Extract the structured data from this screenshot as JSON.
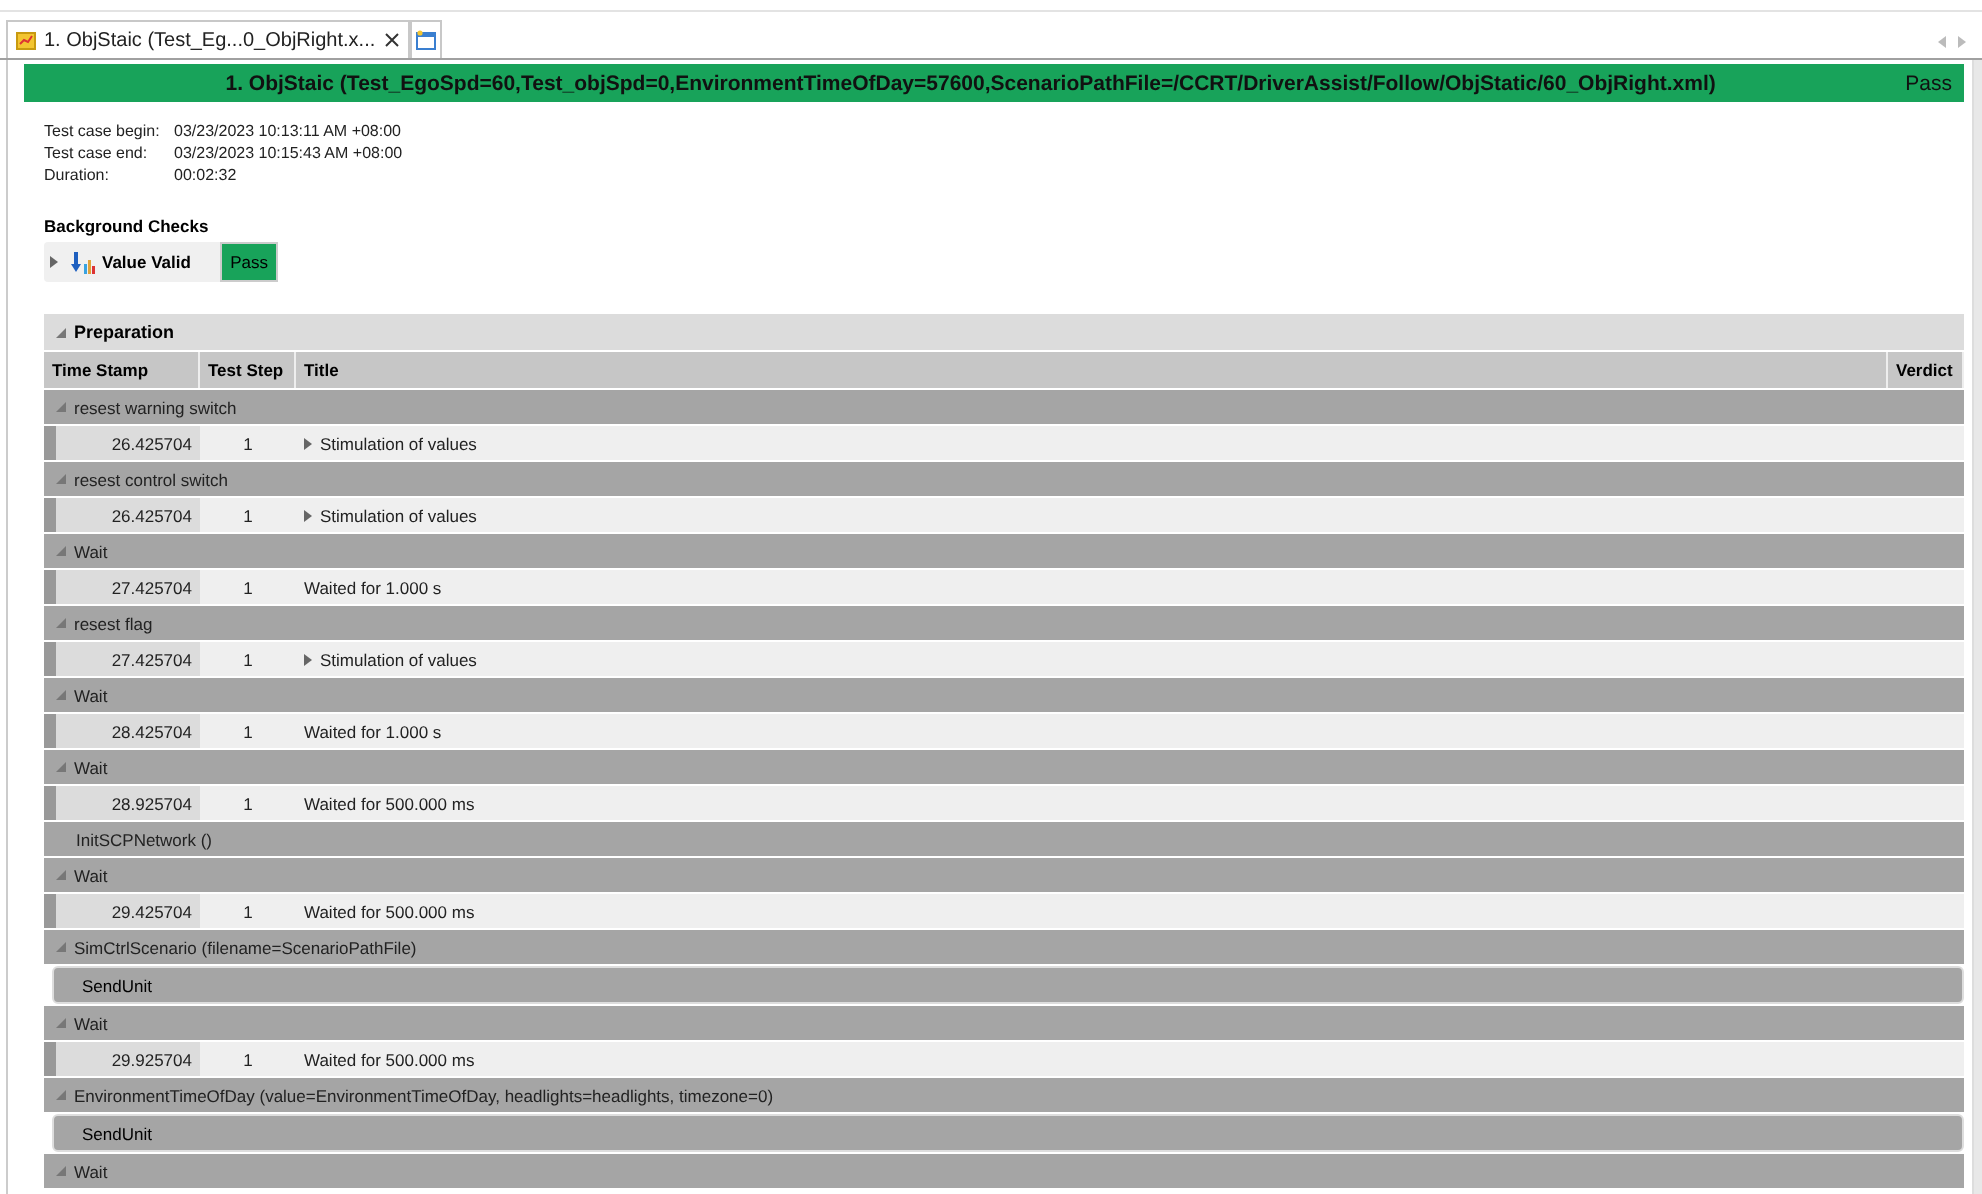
{
  "tab": {
    "title": "1. ObjStaic (Test_Eg...0_ObjRight.x...",
    "selected": true
  },
  "header": {
    "title": "1. ObjStaic (Test_EgoSpd=60,Test_objSpd=0,EnvironmentTimeOfDay=57600,ScenarioPathFile=/CCRT/DriverAssist/Follow/ObjStatic/60_ObjRight.xml)",
    "verdict": "Pass"
  },
  "details": [
    {
      "label": "Test case begin:",
      "value": "03/23/2023 10:13:11 AM +08:00"
    },
    {
      "label": "Test case end:",
      "value": "03/23/2023 10:15:43 AM +08:00"
    },
    {
      "label": "Duration:",
      "value": "00:02:32"
    }
  ],
  "background_checks": {
    "title": "Background Checks",
    "items": [
      {
        "name": "Value Valid",
        "verdict": "Pass",
        "expanded": false
      }
    ]
  },
  "section": {
    "title": "Preparation",
    "expanded": true,
    "columns": [
      "Time Stamp",
      "Test Step",
      "Title",
      "Verdict"
    ],
    "groups": [
      {
        "kind": "group",
        "title": "resest warning switch",
        "expanded": true,
        "rows": [
          {
            "kind": "detail",
            "time": "26.425704",
            "step": "1",
            "title": "Stimulation of values",
            "expanded": false
          }
        ]
      },
      {
        "kind": "group",
        "title": "resest control switch",
        "expanded": true,
        "rows": [
          {
            "kind": "detail",
            "time": "26.425704",
            "step": "1",
            "title": "Stimulation of values",
            "expanded": false
          }
        ]
      },
      {
        "kind": "group",
        "title": "Wait",
        "expanded": true,
        "rows": [
          {
            "kind": "plain",
            "time": "27.425704",
            "step": "1",
            "title": "Waited for 1.000 s"
          }
        ]
      },
      {
        "kind": "group",
        "title": "resest flag",
        "expanded": true,
        "rows": [
          {
            "kind": "detail",
            "time": "27.425704",
            "step": "1",
            "title": "Stimulation of values",
            "expanded": false
          }
        ]
      },
      {
        "kind": "group",
        "title": "Wait",
        "expanded": true,
        "rows": [
          {
            "kind": "plain",
            "time": "28.425704",
            "step": "1",
            "title": "Waited for 1.000 s"
          }
        ]
      },
      {
        "kind": "group",
        "title": "Wait",
        "expanded": true,
        "rows": [
          {
            "kind": "plain",
            "time": "28.925704",
            "step": "1",
            "title": "Waited for 500.000 ms"
          }
        ]
      },
      {
        "kind": "call",
        "title": "InitSCPNetwork ()"
      },
      {
        "kind": "group",
        "title": "Wait",
        "expanded": true,
        "rows": [
          {
            "kind": "plain",
            "time": "29.425704",
            "step": "1",
            "title": "Waited for 500.000 ms"
          }
        ]
      },
      {
        "kind": "group",
        "title": "SimCtrlScenario (filename=ScenarioPathFile)",
        "expanded": true,
        "rows": [
          {
            "kind": "sub",
            "title": "SendUnit"
          }
        ]
      },
      {
        "kind": "group",
        "title": "Wait",
        "expanded": true,
        "rows": [
          {
            "kind": "plain",
            "time": "29.925704",
            "step": "1",
            "title": "Waited for 500.000 ms"
          }
        ]
      },
      {
        "kind": "group",
        "title": "EnvironmentTimeOfDay (value=EnvironmentTimeOfDay, headlights=headlights, timezone=0)",
        "expanded": true,
        "rows": [
          {
            "kind": "sub",
            "title": "SendUnit"
          }
        ]
      },
      {
        "kind": "group",
        "title": "Wait",
        "expanded": true
      }
    ]
  }
}
